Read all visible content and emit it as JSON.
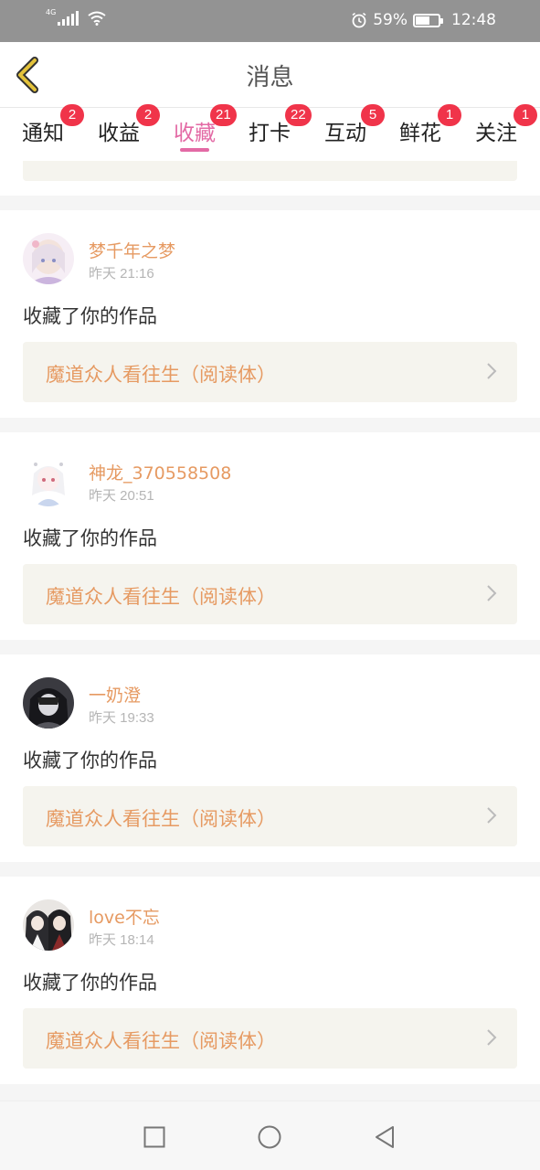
{
  "status_bar": {
    "network": "4G",
    "battery": "59%",
    "time": "12:48"
  },
  "header": {
    "title": "消息"
  },
  "tabs": [
    {
      "label": "通知",
      "badge": "2"
    },
    {
      "label": "收益",
      "badge": "2"
    },
    {
      "label": "收藏",
      "badge": "21",
      "active": true
    },
    {
      "label": "打卡",
      "badge": "22"
    },
    {
      "label": "互动",
      "badge": "5"
    },
    {
      "label": "鲜花",
      "badge": "1"
    },
    {
      "label": "关注",
      "badge": "1"
    }
  ],
  "items": [
    {
      "user": "梦千年之梦",
      "time": "昨天 21:16",
      "action": "收藏了你的作品",
      "work": "魔道众人看往生（阅读体）"
    },
    {
      "user": "神龙_370558508",
      "time": "昨天 20:51",
      "action": "收藏了你的作品",
      "work": "魔道众人看往生（阅读体）"
    },
    {
      "user": "一奶澄",
      "time": "昨天 19:33",
      "action": "收藏了你的作品",
      "work": "魔道众人看往生（阅读体）"
    },
    {
      "user": "love不忘",
      "time": "昨天 18:14",
      "action": "收藏了你的作品",
      "work": "魔道众人看往生（阅读体）"
    }
  ],
  "colors": {
    "accent_pink": "#e36aa5",
    "username_orange": "#e69a62",
    "badge_red": "#f0344a",
    "back_arrow_yellow": "#e3c23a"
  }
}
